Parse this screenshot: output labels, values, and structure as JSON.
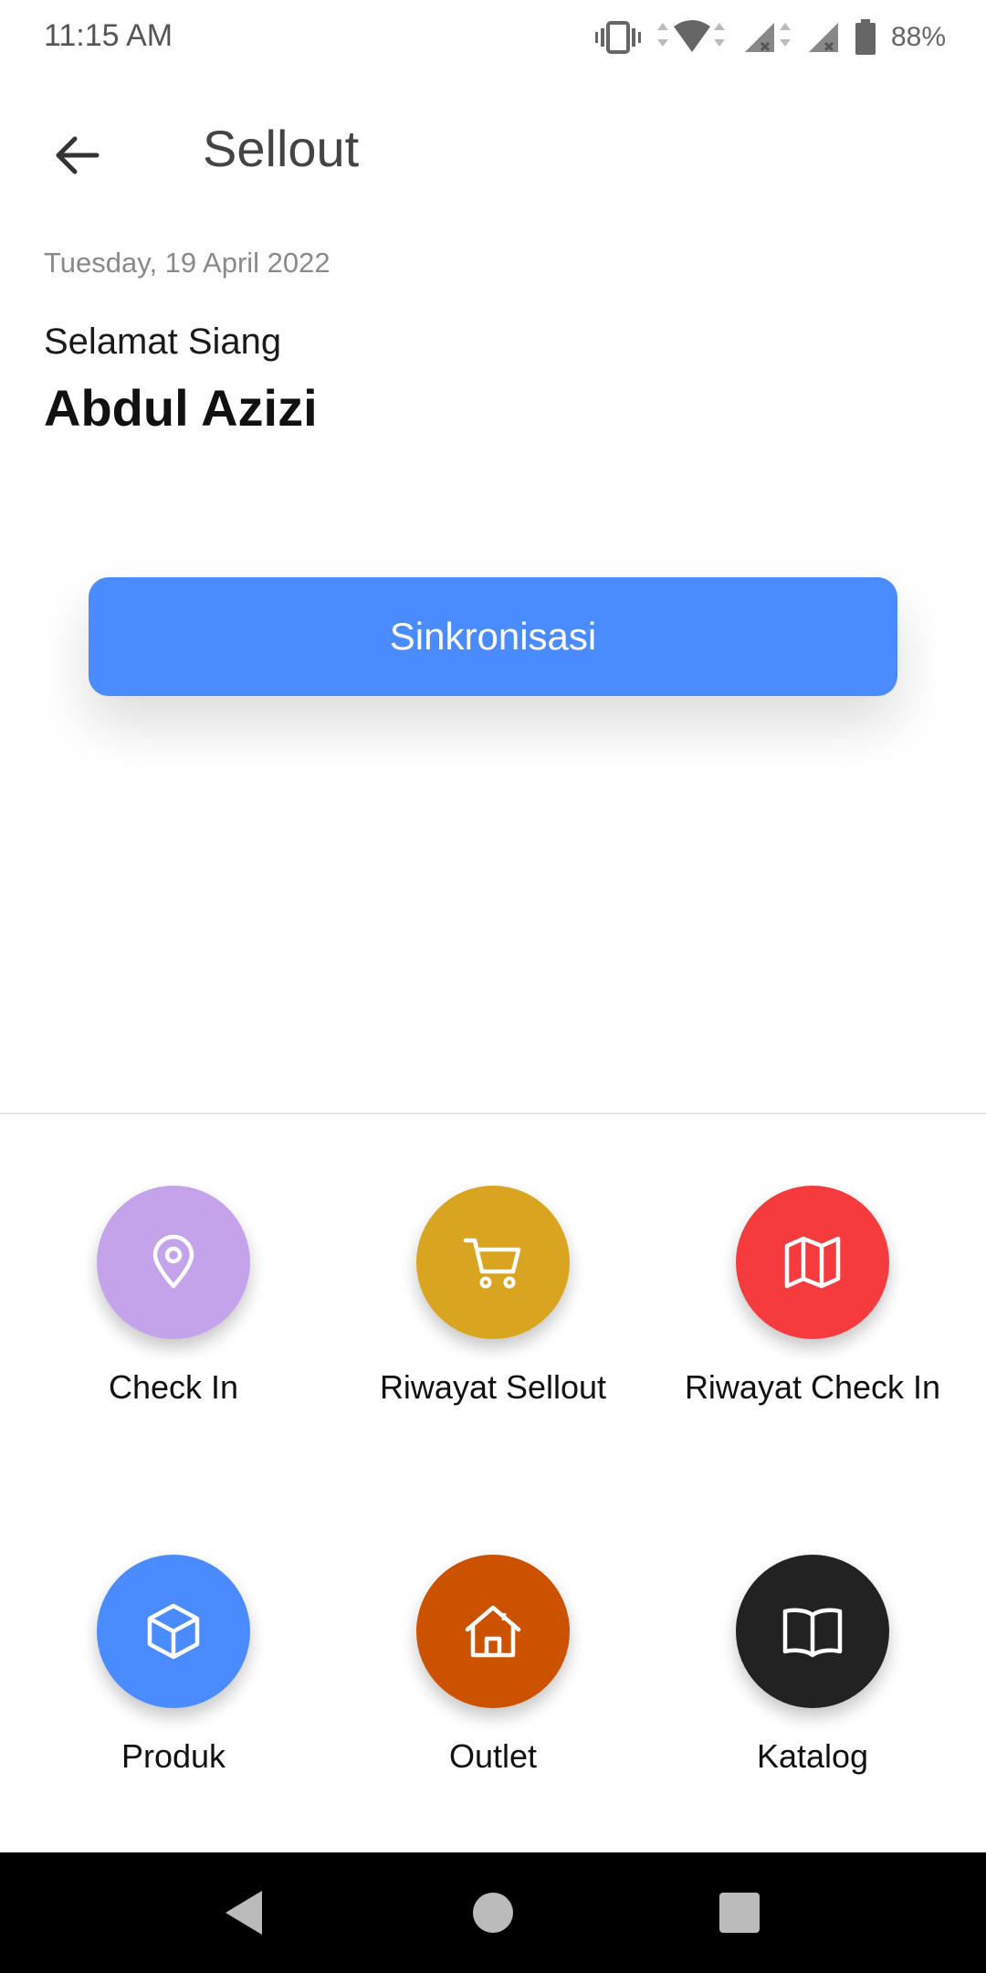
{
  "status_bar": {
    "time": "11:15 AM",
    "battery": "88%",
    "icons": [
      "vibrate-icon",
      "wifi-icon",
      "signal-icon",
      "signal-icon",
      "battery-icon"
    ]
  },
  "app_bar": {
    "title": "Sellout",
    "back_icon": "arrow-left-icon"
  },
  "header": {
    "date": "Tuesday, 19 April 2022",
    "greeting": "Selamat Siang",
    "user_name": "Abdul Azizi"
  },
  "sync_button": {
    "label": "Sinkronisasi",
    "color": "#4a8cff"
  },
  "menu": [
    {
      "label": "Check In",
      "icon": "location-pin-icon",
      "color": "#c4a3ea"
    },
    {
      "label": "Riwayat Sellout",
      "icon": "cart-icon",
      "color": "#d9a520"
    },
    {
      "label": "Riwayat Check In",
      "icon": "map-icon",
      "color": "#f53b3e"
    },
    {
      "label": "Produk",
      "icon": "box-icon",
      "color": "#4a8cff"
    },
    {
      "label": "Outlet",
      "icon": "home-icon",
      "color": "#cc5200"
    },
    {
      "label": "Katalog",
      "icon": "book-icon",
      "color": "#222222"
    }
  ],
  "nav_bar": {
    "icons": [
      "back-triangle-icon",
      "home-circle-icon",
      "recents-square-icon"
    ]
  }
}
